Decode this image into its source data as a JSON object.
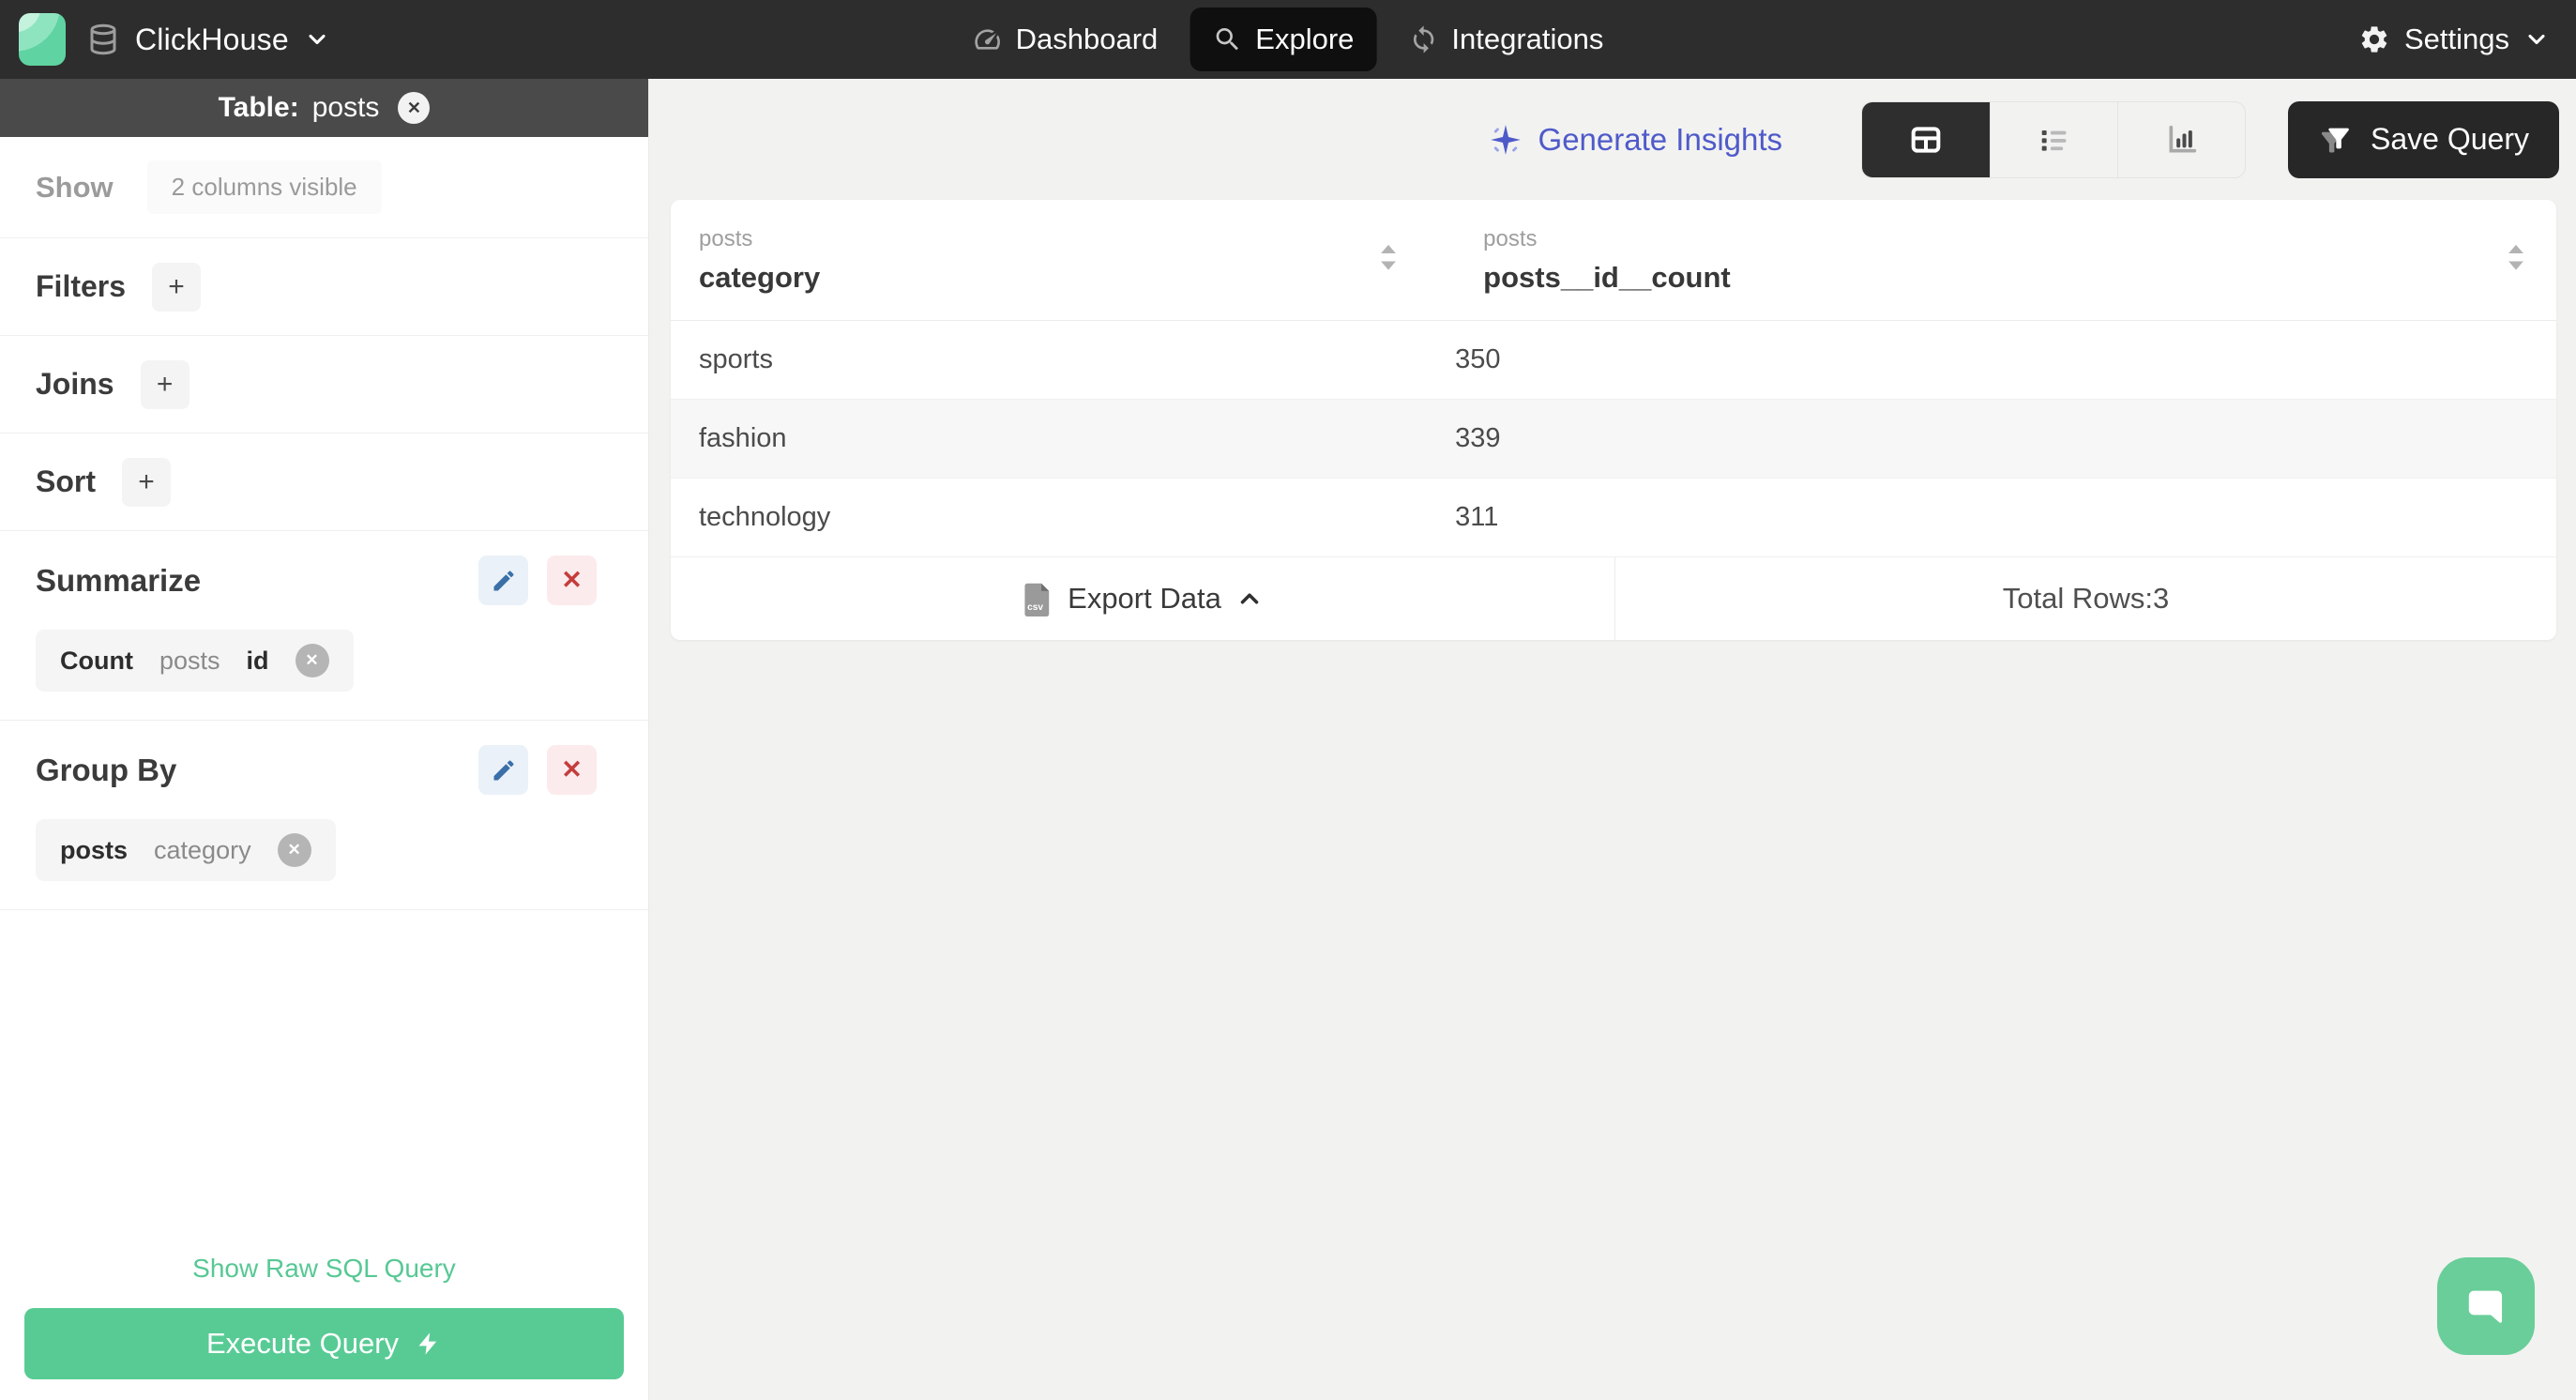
{
  "nav": {
    "brand": "ClickHouse",
    "items": {
      "dashboard": "Dashboard",
      "explore": "Explore",
      "integrations": "Integrations"
    },
    "settings_label": "Settings"
  },
  "sidebar": {
    "banner_label": "Table:",
    "banner_value": "posts",
    "show_label": "Show",
    "show_badge": "2 columns visible",
    "filters_label": "Filters",
    "joins_label": "Joins",
    "sort_label": "Sort",
    "plus": "+",
    "summarize_label": "Summarize",
    "summarize_chip": {
      "agg": "Count",
      "table": "posts",
      "column": "id"
    },
    "groupby_label": "Group By",
    "groupby_chip": {
      "table": "posts",
      "column": "category"
    },
    "raw_sql_link": "Show Raw SQL Query",
    "execute_button": "Execute Query"
  },
  "toolbar": {
    "generate_insights": "Generate Insights",
    "save_query": "Save Query"
  },
  "table": {
    "columns": [
      {
        "group": "posts",
        "name": "category"
      },
      {
        "group": "posts",
        "name": "posts__id__count"
      }
    ],
    "rows": [
      [
        "sports",
        "350"
      ],
      [
        "fashion",
        "339"
      ],
      [
        "technology",
        "311"
      ]
    ],
    "export_label": "Export Data",
    "total_rows": "Total Rows:3"
  },
  "glyphs": {
    "close": "✕"
  },
  "colors": {
    "nav_bg": "#2d2d2d",
    "accent_green": "#58cb95",
    "accent_indigo": "#4f5ac9",
    "banner_bg": "#4a4a4a"
  }
}
